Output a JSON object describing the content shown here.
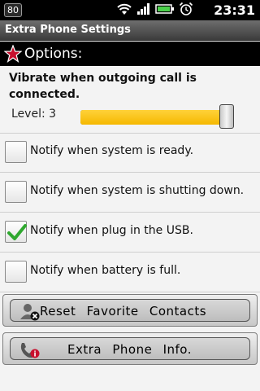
{
  "status_bar": {
    "badge": "80",
    "time": "23:31",
    "icons": [
      "wifi-icon",
      "signal-icon",
      "battery-icon",
      "alarm-icon"
    ]
  },
  "title_bar": {
    "title": "Extra Phone Settings"
  },
  "options": {
    "label": "Options:"
  },
  "vibrate": {
    "title": "Vibrate when outgoing call is connected.",
    "level_label": "Level: 3",
    "level_value": 3,
    "level_fill_fraction": 0.95
  },
  "notify_options": [
    {
      "label": "Notify when system is ready.",
      "checked": false
    },
    {
      "label": "Notify when system is shutting down.",
      "checked": false
    },
    {
      "label": "Notify when plug in the USB.",
      "checked": true
    },
    {
      "label": "Notify when battery is full.",
      "checked": false
    }
  ],
  "buttons": {
    "reset": "Reset Favorite Contacts",
    "info": "Extra Phone Info."
  },
  "colors": {
    "slider_fill": "#f5b800",
    "check_mark": "#2fa82f",
    "star": "#c8102e"
  }
}
